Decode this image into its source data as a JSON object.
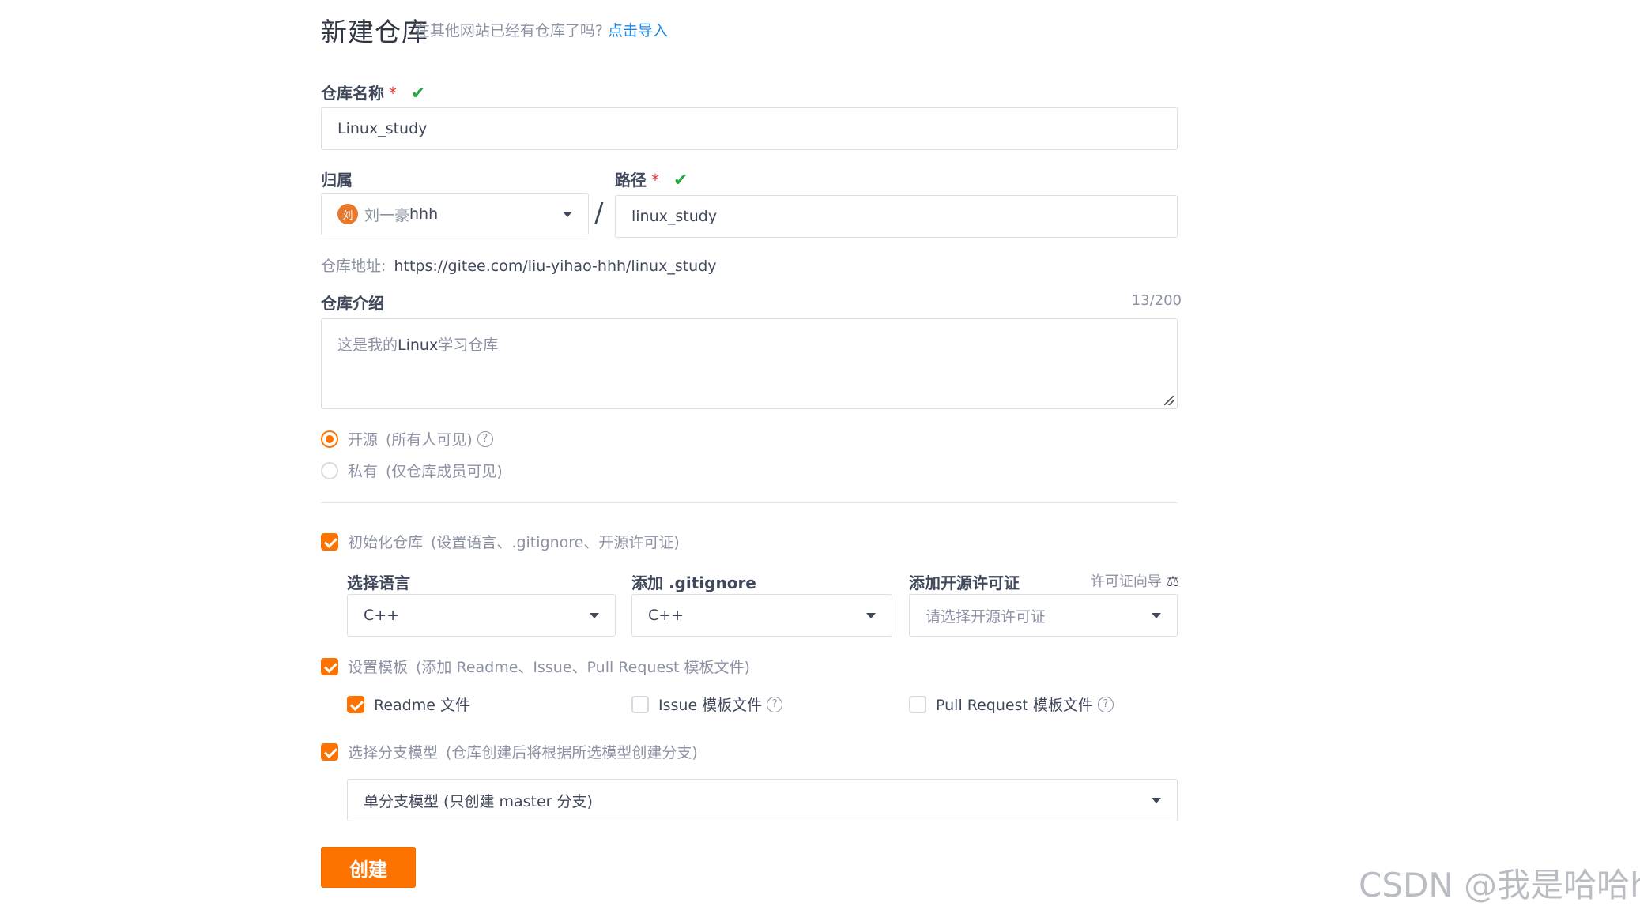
{
  "header": {
    "title": "新建仓库",
    "import_question": "在其他网站已经有仓库了吗?",
    "import_link": "点击导入"
  },
  "repo_name": {
    "label": "仓库名称",
    "required_mark": "*",
    "value": "Linux_study"
  },
  "owner": {
    "label": "归属",
    "avatar_char": "刘",
    "name_prefix": "刘一豪",
    "name_suffix": "hhh"
  },
  "path": {
    "separator": "/",
    "label": "路径",
    "required_mark": "*",
    "value": "linux_study"
  },
  "repo_url": {
    "label": "仓库地址:",
    "value": "https://gitee.com/liu-yihao-hhh/linux_study"
  },
  "description": {
    "label": "仓库介绍",
    "counter": "13/200",
    "value_prefix": "这是我的",
    "value_mid": "Linux",
    "value_suffix": "学习仓库"
  },
  "visibility": {
    "options": [
      {
        "label": "开源",
        "hint": "(所有人可见)",
        "selected": true
      },
      {
        "label": "私有",
        "hint": "(仅仓库成员可见)",
        "selected": false
      }
    ]
  },
  "init_repo": {
    "checked": true,
    "label": "初始化仓库",
    "hint": "(设置语言、.gitignore、开源许可证)"
  },
  "init_selects": {
    "language": {
      "label": "选择语言",
      "value": "C++"
    },
    "gitignore": {
      "label": "添加 .gitignore",
      "value": "C++"
    },
    "license": {
      "label": "添加开源许可证",
      "guide": "许可证向导",
      "placeholder": "请选择开源许可证"
    }
  },
  "templates": {
    "checked": true,
    "label": "设置模板",
    "hint": "(添加 Readme、Issue、Pull Request 模板文件)",
    "items": [
      {
        "label": "Readme 文件",
        "checked": true
      },
      {
        "label": "Issue 模板文件",
        "checked": false
      },
      {
        "label": "Pull Request 模板文件",
        "checked": false
      }
    ]
  },
  "branch_model": {
    "checked": true,
    "label": "选择分支模型",
    "hint": "(仓库创建后将根据所选模型创建分支)",
    "value": "单分支模型 (只创建 master 分支)"
  },
  "submit": {
    "label": "创建"
  },
  "watermark": "CSDN @我是哈哈hh",
  "colors": {
    "accent": "#fe7300",
    "link": "#1e88e5",
    "success": "#28a745",
    "required": "#e53935"
  }
}
